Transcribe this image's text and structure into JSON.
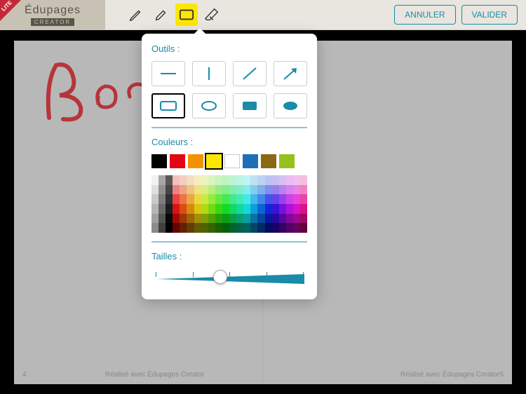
{
  "logo": {
    "main": "Édupages",
    "sub": "CREATOR",
    "corner": "LITE"
  },
  "actions": {
    "cancel": "ANNULER",
    "confirm": "VALIDER"
  },
  "popover": {
    "tools_label": "Outils :",
    "colors_label": "Couleurs :",
    "sizes_label": "Tailles :"
  },
  "swatches": [
    "#000000",
    "#e30613",
    "#f39200",
    "#ffe600",
    "#ffffff",
    "#1d70b7",
    "#8b6914",
    "#95c11f"
  ],
  "selected_swatch": 3,
  "footer": {
    "left_page": "4",
    "right_page": "5",
    "credit": "Réalisé avec Édupages Creator"
  },
  "shapes": [
    "hline",
    "vline",
    "dline",
    "arrow",
    "rect",
    "ellipse",
    "rect-fill",
    "ellipse-fill"
  ],
  "selected_shape": 4,
  "colors": {
    "accent": "#1a8ba8",
    "draw": "#b8343a",
    "toolActive": "#ffe600"
  }
}
